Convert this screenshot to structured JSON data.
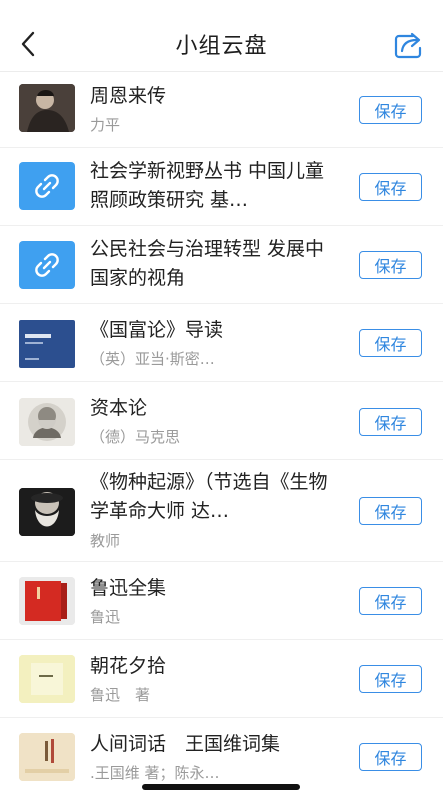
{
  "nav": {
    "title": "小组云盘"
  },
  "items": [
    {
      "title": "周恩来传",
      "subtitle": "力平",
      "thumb": "portrait-photo",
      "save": "保存"
    },
    {
      "title": "社会学新视野丛书  中国儿童照顾政策研究  基…",
      "subtitle": "",
      "thumb": "link-icon",
      "save": "保存"
    },
    {
      "title": "公民社会与治理转型  发展中国家的视角",
      "subtitle": "",
      "thumb": "link-icon",
      "save": "保存"
    },
    {
      "title": "《国富论》导读",
      "subtitle": "（英）亚当·斯密…",
      "thumb": "book-cover-blue",
      "save": "保存"
    },
    {
      "title": "资本论",
      "subtitle": "（德）马克思",
      "thumb": "portrait-marx",
      "save": "保存"
    },
    {
      "title": "《物种起源》（节选自《生物学革命大师  达…",
      "subtitle": "教师",
      "thumb": "portrait-darwin",
      "save": "保存"
    },
    {
      "title": "鲁迅全集",
      "subtitle": "鲁迅",
      "thumb": "book-red",
      "save": "保存"
    },
    {
      "title": "朝花夕拾",
      "subtitle": "鲁迅　著",
      "thumb": "book-cream",
      "save": "保存"
    },
    {
      "title": "人间词话　王国维词集",
      "subtitle": ".王国维 著；陈永…",
      "thumb": "book-beige",
      "save": "保存"
    }
  ]
}
